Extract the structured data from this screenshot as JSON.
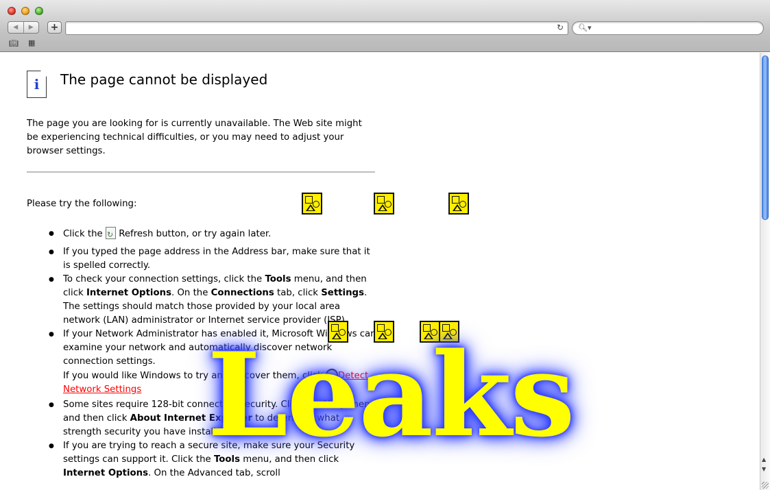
{
  "browser": {
    "address_value": "",
    "search_placeholder": "",
    "icons": {
      "back": "back-arrow-icon",
      "forward": "forward-arrow-icon",
      "add": "plus-icon",
      "reload": "reload-icon",
      "search": "search-icon",
      "bookmarks": "bookmarks-book-icon",
      "top_sites": "grid-icon"
    }
  },
  "page": {
    "title": "The page cannot be displayed",
    "intro": "The page you are looking for is currently unavailable. The Web site might be experiencing technical difficulties, or you may need to adjust your browser settings.",
    "try_text": "Please try the following:",
    "suggestions": {
      "s1_a": "Click the ",
      "s1_b": " Refresh button, or try again later.",
      "s2": "If you typed the page address in the Address bar, make sure that it is spelled correctly.",
      "s3_a": "To check your connection settings, click the ",
      "s3_tools": "Tools",
      "s3_b": " menu, and then click ",
      "s3_options": "Internet Options",
      "s3_c": ". On the ",
      "s3_connections": "Connections",
      "s3_d": " tab, click ",
      "s3_settings": "Settings",
      "s3_e": ". The settings should match those provided by your local area network (LAN) administrator or Internet service provider (ISP).",
      "s4_a": "If your Network Administrator has enabled it, Microsoft Windows can examine your network and automatically discover network connection settings.",
      "s4_b": "If you would like Windows to try and discover them, click ",
      "s4_link": "Detect Network Settings",
      "s5_a": "Some sites require 128-bit connection security. Click the ",
      "s5_help": "Help",
      "s5_b": " menu and then click ",
      "s5_about": "About Internet Explorer",
      "s5_c": " to determine what strength security you have installed.",
      "s6_a": "If you are trying to reach a secure site, make sure your Security settings can support it. Click the ",
      "s6_tools": "Tools",
      "s6_b": " menu, and then click ",
      "s6_options": "Internet Options",
      "s6_c": ". On the Advanced tab, scroll"
    },
    "overlay_text": "Leaks",
    "colors": {
      "link": "#ff0000",
      "info_icon": "#1f3fd0",
      "overlay_fill": "#ffff00",
      "overlay_glow": "#2a37ff",
      "plugin_placeholder": "#ffef00"
    }
  }
}
